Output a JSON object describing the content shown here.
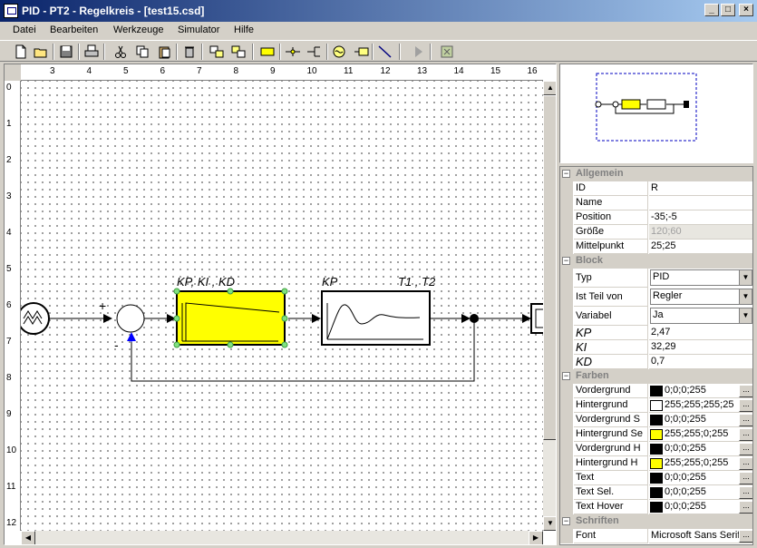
{
  "window": {
    "title": "PID - PT2 - Regelkreis - [test15.csd]",
    "min_label": "_",
    "max_label": "□",
    "close_label": "×"
  },
  "menu": [
    "Datei",
    "Bearbeiten",
    "Werkzeuge",
    "Simulator",
    "Hilfe"
  ],
  "toolbar": {
    "buttons": [
      "new-icon",
      "open-icon",
      "save-icon",
      "print-icon",
      "cut-icon",
      "copy-icon",
      "paste-icon",
      "delete-icon",
      "group-icon",
      "ungroup-icon",
      "block-icon",
      "junction-icon",
      "summation-icon",
      "source-icon",
      "sink-icon",
      "connector-icon",
      "run-icon",
      "stop-icon"
    ]
  },
  "ruler": {
    "top": [
      "3",
      "4",
      "5",
      "6",
      "7",
      "8",
      "9",
      "10",
      "11",
      "12",
      "13",
      "14",
      "15",
      "16"
    ],
    "left": [
      "0",
      "1",
      "2",
      "3",
      "4",
      "5",
      "6",
      "7",
      "8",
      "9",
      "10",
      "11",
      "12"
    ]
  },
  "diagram": {
    "plus_sign": "+",
    "minus_sign": "-",
    "pid_label": "KP, KI , KD",
    "pt2_label_left": "KP",
    "pt2_label_right": "T1 , T2"
  },
  "properties": {
    "categories": {
      "allgemein": "Allgemein",
      "block": "Block",
      "farben": "Farben",
      "schriften": "Schriften"
    },
    "allgemein": [
      {
        "name": "ID",
        "value": "R"
      },
      {
        "name": "Name",
        "value": ""
      },
      {
        "name": "Position",
        "value": "-35;-5"
      },
      {
        "name": "Größe",
        "value": "120;60"
      },
      {
        "name": "Mittelpunkt",
        "value": "25;25"
      }
    ],
    "block": {
      "typ_label": "Typ",
      "typ_value": "PID",
      "teil_label": "Ist Teil von",
      "teil_value": "Regler",
      "variabel_label": "Variabel",
      "variabel_value": "Ja",
      "kp_label": "KP",
      "kp_value": "2,47",
      "ki_label": "KI",
      "ki_value": "32,29",
      "kd_label": "KD",
      "kd_value": "0,7"
    },
    "farben": [
      {
        "name": "Vordergrund",
        "value": "0;0;0;255",
        "color": "#000000"
      },
      {
        "name": "Hintergrund",
        "value": "255;255;255;25",
        "color": "#ffffff"
      },
      {
        "name": "Vordergrund S",
        "value": "0;0;0;255",
        "color": "#000000"
      },
      {
        "name": "Hintergrund Se",
        "value": "255;255;0;255",
        "color": "#ffff00"
      },
      {
        "name": "Vordergrund H",
        "value": "0;0;0;255",
        "color": "#000000"
      },
      {
        "name": "Hintergrund H",
        "value": "255;255;0;255",
        "color": "#ffff00"
      },
      {
        "name": "Text",
        "value": "0;0;0;255",
        "color": "#000000"
      },
      {
        "name": "Text Sel.",
        "value": "0;0;0;255",
        "color": "#000000"
      },
      {
        "name": "Text Hover",
        "value": "0;0;0;255",
        "color": "#000000"
      }
    ],
    "schriften": {
      "name": "Font",
      "value": "Microsoft Sans Serif"
    },
    "ellipsis": "..."
  }
}
